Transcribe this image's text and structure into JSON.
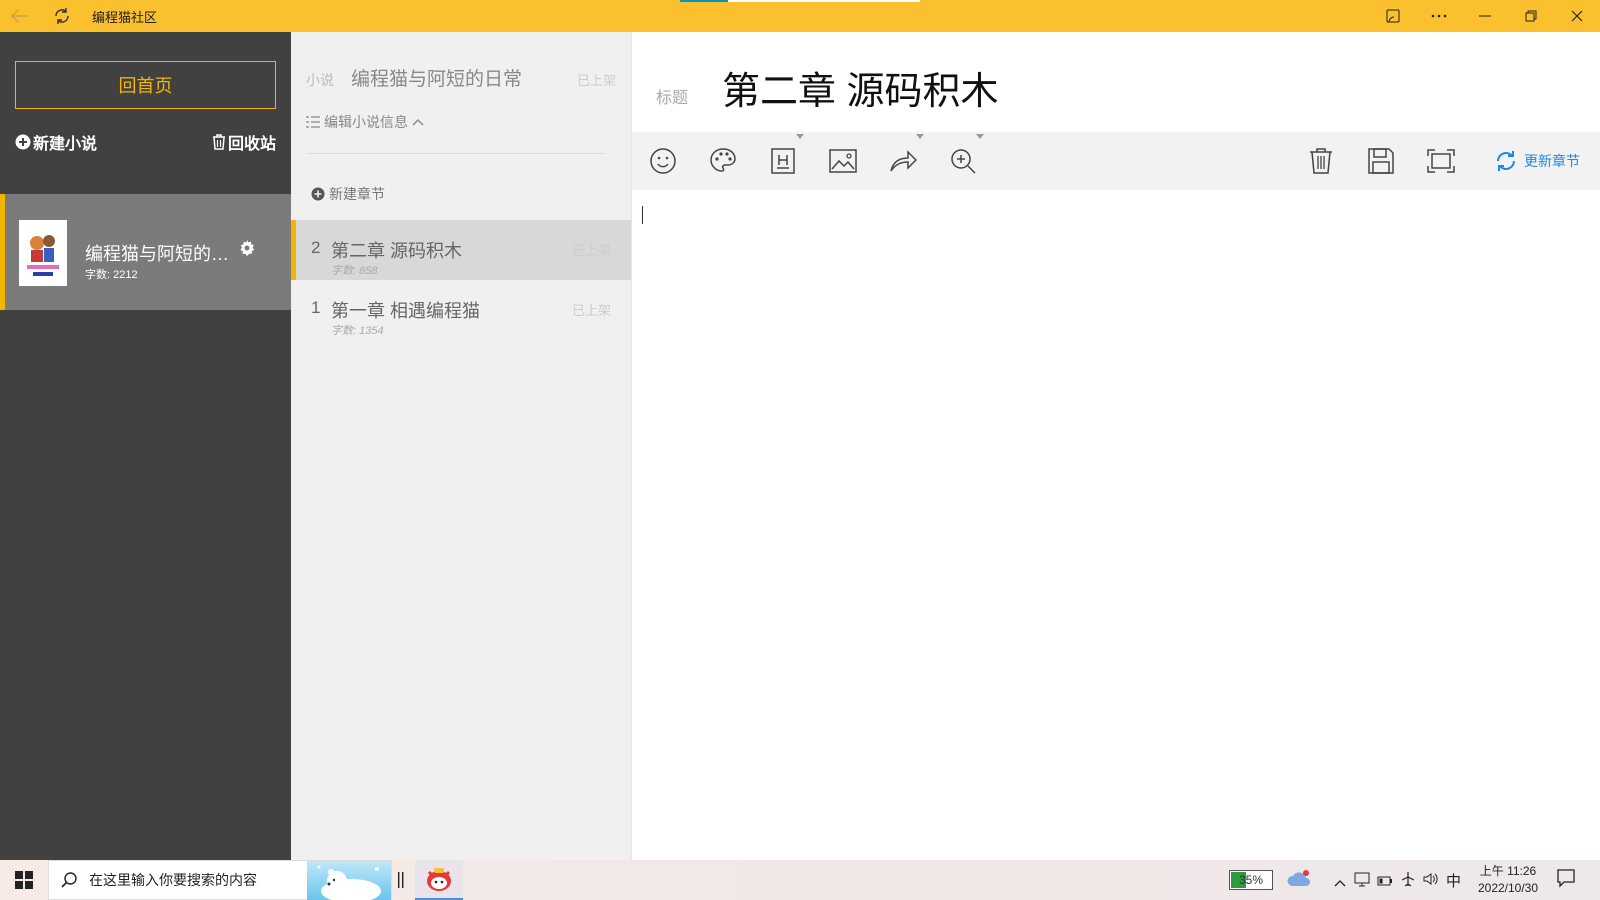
{
  "titlebar": {
    "app_title": "编程猫社区",
    "back_icon": "back-arrow-icon",
    "refresh_icon": "refresh-icon",
    "cast_icon": "cast-icon",
    "more_icon": "more-icon",
    "minimize_icon": "minimize-icon",
    "restore_icon": "restore-icon",
    "close_icon": "close-icon"
  },
  "sidebar": {
    "home_label": "回首页",
    "new_novel_label": "新建小说",
    "recycle_label": "回收站",
    "novels": [
      {
        "title": "编程猫与阿短的日常",
        "count_label": "字数: 2212"
      }
    ]
  },
  "chapters_panel": {
    "novel_label": "小说",
    "novel_title": "编程猫与阿短的日常",
    "novel_status": "已上架",
    "edit_info_label": "编辑小说信息",
    "new_chapter_label": "新建章节",
    "chapters": [
      {
        "num": "2",
        "title": "第二章 源码积木",
        "count": "字数: 858",
        "status": "已上架",
        "active": true
      },
      {
        "num": "1",
        "title": "第一章 相遇编程猫",
        "count": "字数: 1354",
        "status": "已上架",
        "active": false
      }
    ]
  },
  "editor": {
    "title_label": "标题",
    "title_value": "第二章 源码积木",
    "update_label": "更新章节",
    "tools": [
      "emoji-icon",
      "palette-icon",
      "heading-icon",
      "image-icon",
      "share-icon",
      "zoom-in-icon",
      "delete-icon",
      "save-icon",
      "fullscreen-icon"
    ],
    "content": ""
  },
  "taskbar": {
    "search_placeholder": "在这里输入你要搜索的内容",
    "battery_percent": "35%",
    "ime": "中",
    "time": "上午 11:26",
    "date": "2022/10/30"
  },
  "colors": {
    "accent": "#fbc02d",
    "sidebar_bg": "#414141",
    "selected": "#f4b400",
    "link_blue": "#1e88e5"
  }
}
